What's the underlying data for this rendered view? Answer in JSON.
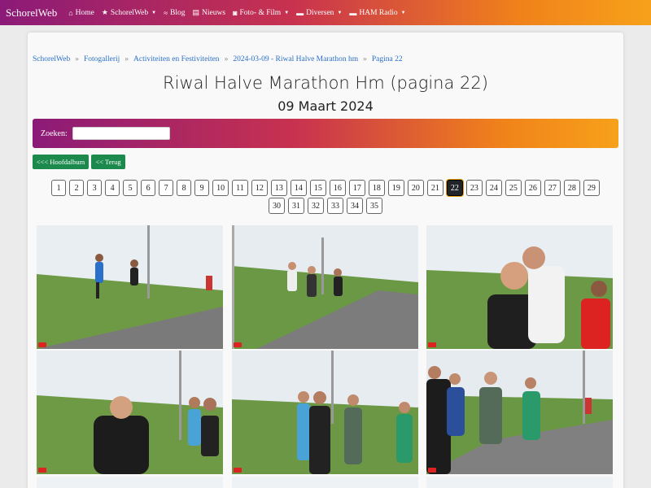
{
  "nav": {
    "brand": "SchorelWeb",
    "items": [
      {
        "label": "Home",
        "icon": "home-icon",
        "glyph": "⌂",
        "dropdown": false
      },
      {
        "label": "SchorelWeb",
        "icon": "star-icon",
        "glyph": "★",
        "dropdown": true
      },
      {
        "label": "Blog",
        "icon": "rss-icon",
        "glyph": "≈",
        "dropdown": false
      },
      {
        "label": "Nieuws",
        "icon": "newspaper-icon",
        "glyph": "▤",
        "dropdown": false
      },
      {
        "label": "Foto- & Film",
        "icon": "camera-icon",
        "glyph": "◙",
        "dropdown": true
      },
      {
        "label": "Diversen",
        "icon": "folder-icon",
        "glyph": "▬",
        "dropdown": true
      },
      {
        "label": "HAM Radio",
        "icon": "folder-icon",
        "glyph": "▬",
        "dropdown": true
      }
    ]
  },
  "breadcrumb": [
    "SchorelWeb",
    "Fotogallerij",
    "Activiteiten en Festiviteiten",
    "2024-03-09 - Riwal Halve Marathon hm",
    "Pagina 22"
  ],
  "page": {
    "title": "Riwal Halve Marathon Hm (pagina 22)",
    "subtitle": "09 Maart 2024"
  },
  "search": {
    "label": "Zoeken:",
    "value": "",
    "placeholder": ""
  },
  "buttons": {
    "main_album": "<<< Hoofdalbum",
    "back": "<< Terug"
  },
  "pagination": {
    "current": "22",
    "row1": [
      "1",
      "2",
      "3",
      "4",
      "5",
      "6",
      "7",
      "8",
      "9",
      "10",
      "11",
      "12",
      "13",
      "14",
      "15",
      "16",
      "17",
      "18",
      "19",
      "20",
      "21",
      "22",
      "23",
      "24",
      "25",
      "26",
      "27",
      "28",
      "29"
    ],
    "row2": [
      "30",
      "31",
      "32",
      "33",
      "34",
      "35"
    ]
  },
  "photos": [
    "runner-photo-1",
    "runner-photo-2",
    "runner-photo-3",
    "runner-photo-4",
    "runner-photo-5",
    "runner-photo-6"
  ],
  "colors": {
    "accent_start": "#8b1a78",
    "accent_end": "#f7a11a",
    "button_green": "#1b8a4c",
    "link": "#2a6fc9"
  }
}
